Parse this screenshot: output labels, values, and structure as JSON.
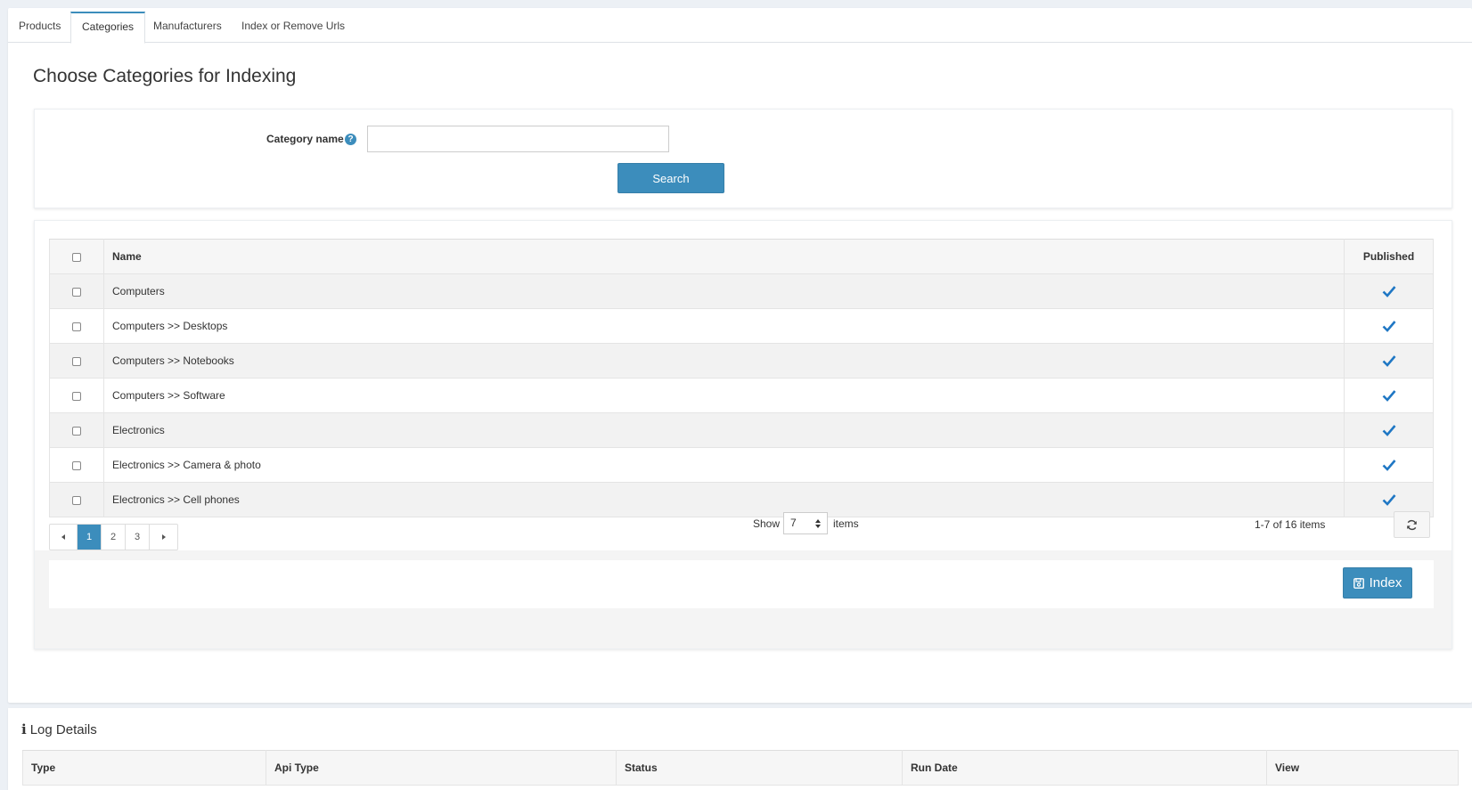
{
  "tabs": [
    {
      "label": "Products",
      "active": false
    },
    {
      "label": "Categories",
      "active": true
    },
    {
      "label": "Manufacturers",
      "active": false
    },
    {
      "label": "Index or Remove Urls",
      "active": false
    }
  ],
  "page_title": "Choose Categories for Indexing",
  "search": {
    "label": "Category name",
    "help_icon": "?",
    "value": "",
    "button_label": "Search"
  },
  "grid": {
    "columns": {
      "name": "Name",
      "published": "Published"
    },
    "rows": [
      {
        "name": "Computers",
        "published": true
      },
      {
        "name": "Computers >> Desktops",
        "published": true
      },
      {
        "name": "Computers >> Notebooks",
        "published": true
      },
      {
        "name": "Computers >> Software",
        "published": true
      },
      {
        "name": "Electronics",
        "published": true
      },
      {
        "name": "Electronics >> Camera & photo",
        "published": true
      },
      {
        "name": "Electronics >> Cell phones",
        "published": true
      }
    ],
    "accent_color": "#3c8dbc",
    "check_color": "#1f77c4"
  },
  "pager": {
    "pages": [
      "1",
      "2",
      "3"
    ],
    "current_page": "1",
    "show_label": "Show",
    "page_size": "7",
    "items_label": "items",
    "count_text": "1-7 of 16 items"
  },
  "actions": {
    "index_label": "Index"
  },
  "log": {
    "title": "Log Details",
    "columns": [
      "Type",
      "Api Type",
      "Status",
      "Run Date",
      "View"
    ]
  }
}
